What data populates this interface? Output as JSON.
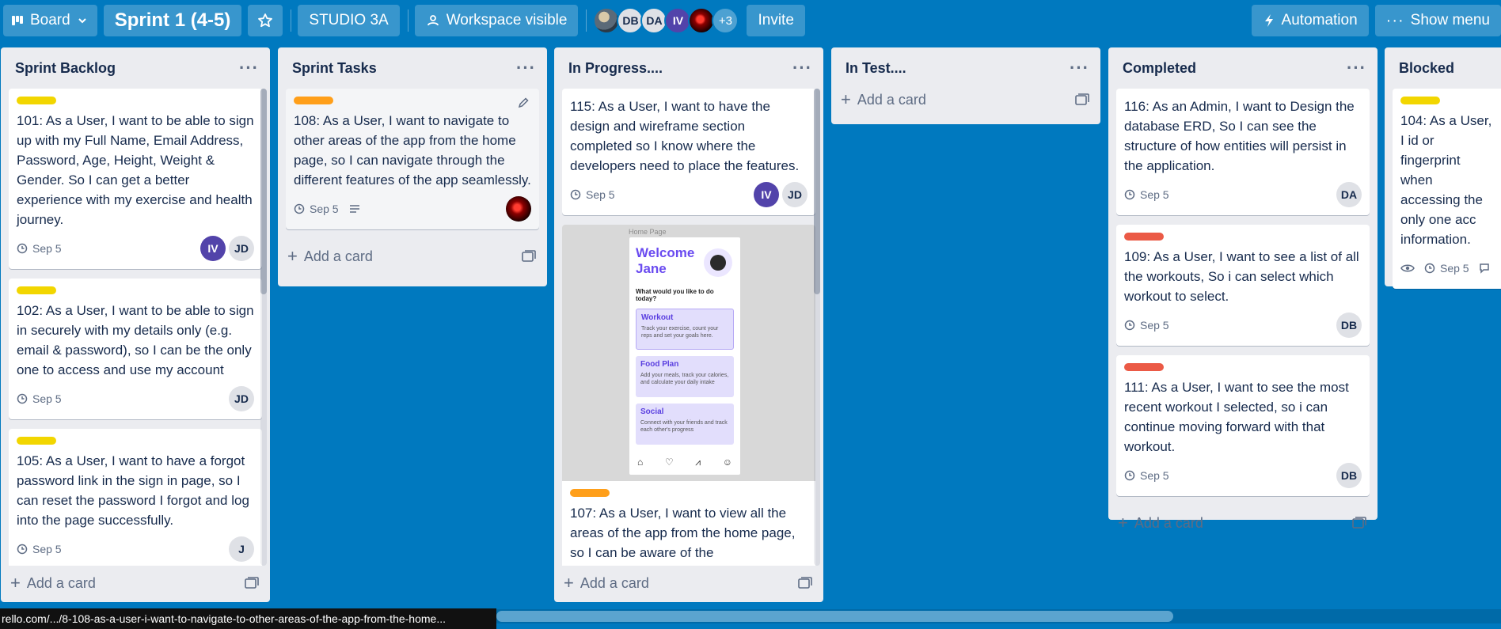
{
  "header": {
    "view_label": "Board",
    "board_title": "Sprint 1 (4-5)",
    "workspace_name": "STUDIO 3A",
    "visibility_label": "Workspace visible",
    "members": [
      "DB",
      "DA",
      "IV"
    ],
    "more_members": "+3",
    "invite_label": "Invite",
    "automation_label": "Automation",
    "menu_label": "Show menu"
  },
  "add_card_label": "Add a card",
  "lists": [
    {
      "title": "Sprint Backlog",
      "cards": [
        {
          "text": "101: As a User, I want to be able to sign up with my Full Name, Email Address, Password, Age, Height, Weight & Gender. So I can get a better experience with my exercise and health journey.",
          "due": "Sep 5",
          "members": [
            "IV",
            "JD"
          ]
        },
        {
          "text": "102: As a User, I want to be able to sign in securely with my details only (e.g. email & password), so I can be the only one to access and use my account",
          "due": "Sep 5",
          "members": [
            "JD"
          ]
        },
        {
          "text": "105: As a User, I want to have a forgot password link in the sign in page, so I can reset the password I forgot and log into the page successfully.",
          "due": "Sep 5",
          "members": [
            "J"
          ]
        }
      ]
    },
    {
      "title": "Sprint Tasks",
      "cards": [
        {
          "text": "108: As a User, I want to navigate to other areas of the app from the home page, so I can navigate through the different features of the app seamlessly.",
          "due": "Sep 5"
        }
      ]
    },
    {
      "title": "In Progress....",
      "cards": [
        {
          "text": "115: As a User, I want to have the design and wireframe section completed so I know where the developers need to place the features.",
          "due": "Sep 5",
          "members": [
            "IV",
            "JD"
          ]
        },
        {
          "text": "107: As a User, I want to view all the areas of the app from the home page, so I can be aware of the"
        }
      ],
      "cover": {
        "caption": "Home Page",
        "title": "Welcome Jane",
        "question": "What would you like to do today?",
        "tiles": [
          {
            "title": "Workout",
            "desc": "Track your exercise, count your reps and set your goals here."
          },
          {
            "title": "Food Plan",
            "desc": "Add your meals, track your calories, and calculate your daily intake"
          },
          {
            "title": "Social",
            "desc": "Connect with your friends and track each other's progress"
          }
        ]
      }
    },
    {
      "title": "In Test....",
      "cards": []
    },
    {
      "title": "Completed",
      "cards": [
        {
          "text": "116: As an Admin, I want to Design the database ERD, So I can see the structure of how entities will persist in the application.",
          "due": "Sep 5",
          "members": [
            "DA"
          ]
        },
        {
          "text": "109: As a User, I want to see a list of all the workouts, So i can select which workout to select.",
          "due": "Sep 5",
          "members": [
            "DB"
          ]
        },
        {
          "text": "111: As a User, I want to see the most recent workout I selected, so i can continue moving forward with that workout.",
          "due": "Sep 5",
          "members": [
            "DB"
          ]
        }
      ]
    },
    {
      "title": "Blocked",
      "cards": [
        {
          "text": "104: As a User, I id or fingerprint when accessing the only one acc information.",
          "due": "Sep 5"
        }
      ]
    }
  ],
  "label_colors": {
    "yellow": "#f2d600",
    "orange": "#ff9f1a",
    "red": "#eb5a46"
  },
  "status_url": "rello.com/.../8-108-as-a-user-i-want-to-navigate-to-other-areas-of-the-app-from-the-home..."
}
